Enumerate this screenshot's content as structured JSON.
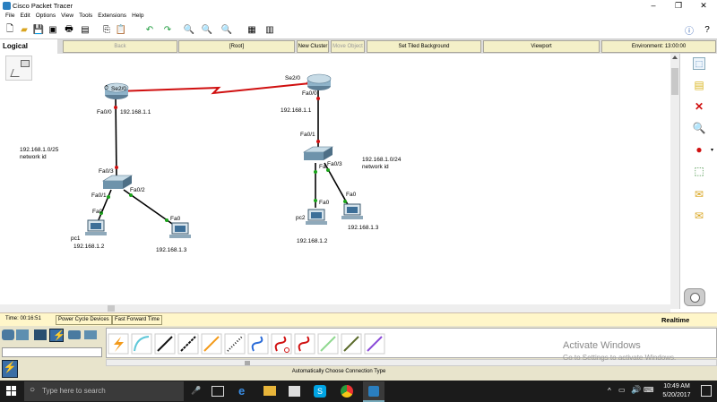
{
  "app": {
    "title": "Cisco Packet Tracer"
  },
  "window_controls": {
    "minimize": "–",
    "restore": "❐",
    "close": "✕"
  },
  "menu": [
    "File",
    "Edit",
    "Options",
    "View",
    "Tools",
    "Extensions",
    "Help"
  ],
  "navbar": {
    "logical": "Logical",
    "back": "Back",
    "root": "[Root]",
    "new_cluster": "New Cluster",
    "move_object": "Move Object",
    "set_tiled_background": "Set Tiled Background",
    "viewport": "Viewport",
    "environment": "Environment: 13:00:00"
  },
  "topology": {
    "routers": [
      {
        "id": "router-left",
        "labels": {
          "serial": "Se2/0",
          "fa": "Fa0/0",
          "ip": "192.168.1.1"
        }
      },
      {
        "id": "router-right",
        "labels": {
          "serial": "Se2/0",
          "fa": "Fa0/0",
          "ip": "192.168.1.1"
        }
      }
    ],
    "switches": [
      {
        "id": "switch-left",
        "labels": {
          "up": "Fa0/3",
          "p1": "Fa0/1",
          "p2": "Fa0/2"
        }
      },
      {
        "id": "switch-right",
        "labels": {
          "up": "Fa0/1",
          "p2": "Fa",
          "p3": "Fa0/3"
        }
      }
    ],
    "pcs": [
      {
        "id": "pc1",
        "name": "pc1",
        "port": "Fa0",
        "ip": "192.168.1.2"
      },
      {
        "id": "pc-left-2",
        "name": "",
        "port": "Fa0",
        "ip": "192.168.1.3"
      },
      {
        "id": "pc2",
        "name": "pc2",
        "port": "Fa0",
        "ip": "192.168.1.2"
      },
      {
        "id": "pc-right-2",
        "name": "",
        "port": "Fa0",
        "ip": "192.168.1.3"
      }
    ],
    "notes": [
      {
        "line1": "192.168.1.0/25",
        "line2": "network id"
      },
      {
        "line1": "192.168.1.0/24",
        "line2": "network id"
      }
    ]
  },
  "status": {
    "time": "Time: 00:16:51",
    "power_cycle": "Power Cycle Devices",
    "fast_forward": "Fast Forward Time",
    "realtime": "Realtime"
  },
  "connections": {
    "hint": "Automatically Choose Connection Type",
    "cables": [
      "automatic",
      "console",
      "copper-straight",
      "copper-cross",
      "fiber",
      "phone",
      "coaxial",
      "serial-dce",
      "serial-dte",
      "octal",
      "iot",
      "usb"
    ]
  },
  "watermark": {
    "line1": "Activate Windows",
    "line2": "Go to Settings to activate Windows."
  },
  "taskbar": {
    "search_placeholder": "Type here to search",
    "time": "10:49 AM",
    "date": "5/20/2017"
  },
  "colors": {
    "serial_link": "#d01010",
    "ethernet_link": "#000000",
    "port_up": "#19a319",
    "port_down": "#d01010",
    "status_bar": "#fff6c9"
  }
}
